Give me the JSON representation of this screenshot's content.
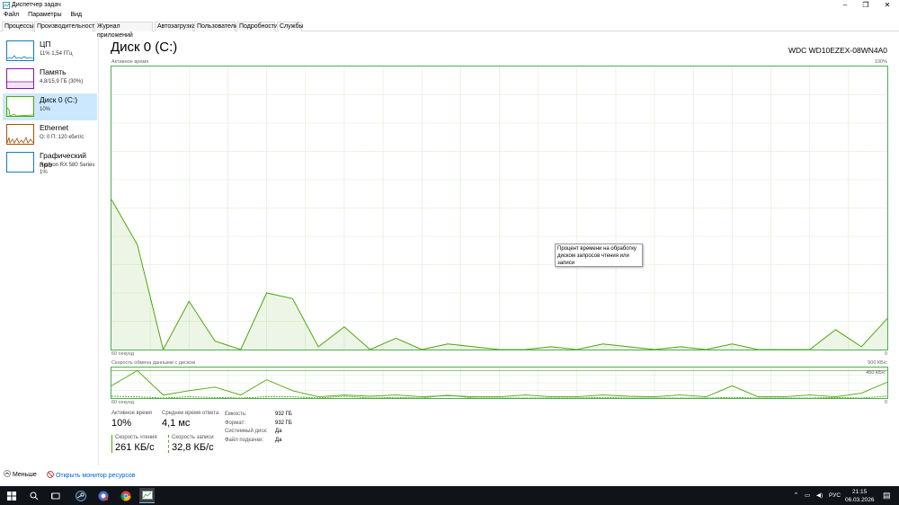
{
  "window": {
    "title": "Диспетчер задач",
    "minimize": "–",
    "maximize": "❐",
    "close": "✕"
  },
  "menu": [
    "Файл",
    "Параметры",
    "Вид"
  ],
  "tabs": [
    "Процессы",
    "Производительность",
    "Журнал приложений",
    "Автозагрузка",
    "Пользователи",
    "Подробности",
    "Службы"
  ],
  "sidebar": {
    "items": [
      {
        "name": "ЦП",
        "sub1": "11% 1,54 ГГц",
        "sub2": "",
        "sub3": "",
        "color": "#117dbb"
      },
      {
        "name": "Память",
        "sub1": "4,8/15,9 ГБ (30%)",
        "sub2": "",
        "sub3": "",
        "color": "#8b12ae"
      },
      {
        "name": "Диск 0 (C:)",
        "sub1": "10%",
        "sub2": "",
        "sub3": "",
        "color": "#4da60c"
      },
      {
        "name": "Ethernet",
        "sub1": "О: 0 П: 120 кбит/с",
        "sub2": "",
        "sub3": "",
        "color": "#a74f01"
      },
      {
        "name": "Графический про",
        "sub1": "Radeon RX 580 Series",
        "sub2": "1%",
        "sub3": "",
        "color": "#117dbb"
      }
    ]
  },
  "main": {
    "title": "Диск 0 (C:)",
    "device": "WDC WD10EZEX-08WN4A0",
    "chart1": {
      "label": "Активное время",
      "max_label": "100%",
      "time_label": "60 секунд",
      "min_label": "0"
    },
    "chart2": {
      "label": "Скорость обмена данными с диском",
      "max_label": "500 КБ/с",
      "ref_label": "450 КБ/с",
      "time_label": "60 секунд",
      "min_label": "0"
    },
    "tooltip": "Процент времени на обработку диском запросов чтения или записи"
  },
  "stats": {
    "active_time_label": "Активное время",
    "active_time": "10%",
    "avg_response_label": "Среднее время ответа",
    "avg_response": "4,1 мс",
    "read_speed_label": "Скорость чтения",
    "read_speed": "261 КБ/с",
    "write_speed_label": "Скорость записи",
    "write_speed": "32,8 КБ/с"
  },
  "props": [
    {
      "key": "Емкость:",
      "value": "932 ГБ"
    },
    {
      "key": "Формат:",
      "value": "932 ГБ"
    },
    {
      "key": "Системный диск:",
      "value": "Да"
    },
    {
      "key": "Файл подкачки:",
      "value": "Да"
    }
  ],
  "footer": {
    "less": "Меньше",
    "monitor": "Открыть монитор ресурсов"
  },
  "taskbar": {
    "lang": "РУС",
    "time": "21:15",
    "date": "06.03.2026"
  },
  "chart_data": [
    {
      "type": "area",
      "title": "Активное время",
      "xlabel": "60 секунд",
      "ylabel": "",
      "ylim": [
        0,
        100
      ],
      "x": [
        60,
        58,
        56,
        54,
        52,
        50,
        48,
        46,
        44,
        42,
        40,
        38,
        36,
        34,
        32,
        30,
        28,
        26,
        24,
        22,
        20,
        18,
        16,
        14,
        12,
        10,
        8,
        6,
        4,
        2,
        0
      ],
      "series": [
        {
          "values": [
            53,
            37,
            0,
            17,
            3,
            0,
            20,
            18,
            1,
            8,
            0,
            4,
            0,
            2,
            1,
            0,
            0,
            1,
            0,
            2,
            1,
            0,
            1,
            0,
            2,
            0,
            0,
            0,
            7,
            1,
            11
          ]
        }
      ]
    },
    {
      "type": "line",
      "title": "Скорость обмена данными с диском",
      "xlabel": "60 секунд",
      "ylim": [
        0,
        500
      ],
      "x": [
        60,
        58,
        56,
        54,
        52,
        50,
        48,
        46,
        44,
        42,
        40,
        38,
        36,
        34,
        32,
        30,
        28,
        26,
        24,
        22,
        20,
        18,
        16,
        14,
        12,
        10,
        8,
        6,
        4,
        2,
        0
      ],
      "series": [
        {
          "values": [
            200,
            450,
            50,
            120,
            180,
            50,
            300,
            120,
            20,
            50,
            30,
            50,
            20,
            40,
            20,
            20,
            50,
            20,
            20,
            50,
            30,
            20,
            50,
            20,
            200,
            20,
            20,
            50,
            20,
            80,
            261
          ]
        },
        {
          "values": [
            30,
            20,
            0,
            20,
            10,
            0,
            20,
            20,
            0,
            30,
            0,
            10,
            0,
            50,
            0,
            0,
            0,
            0,
            0,
            10,
            0,
            0,
            0,
            0,
            10,
            0,
            0,
            0,
            10,
            0,
            33
          ]
        }
      ]
    }
  ]
}
